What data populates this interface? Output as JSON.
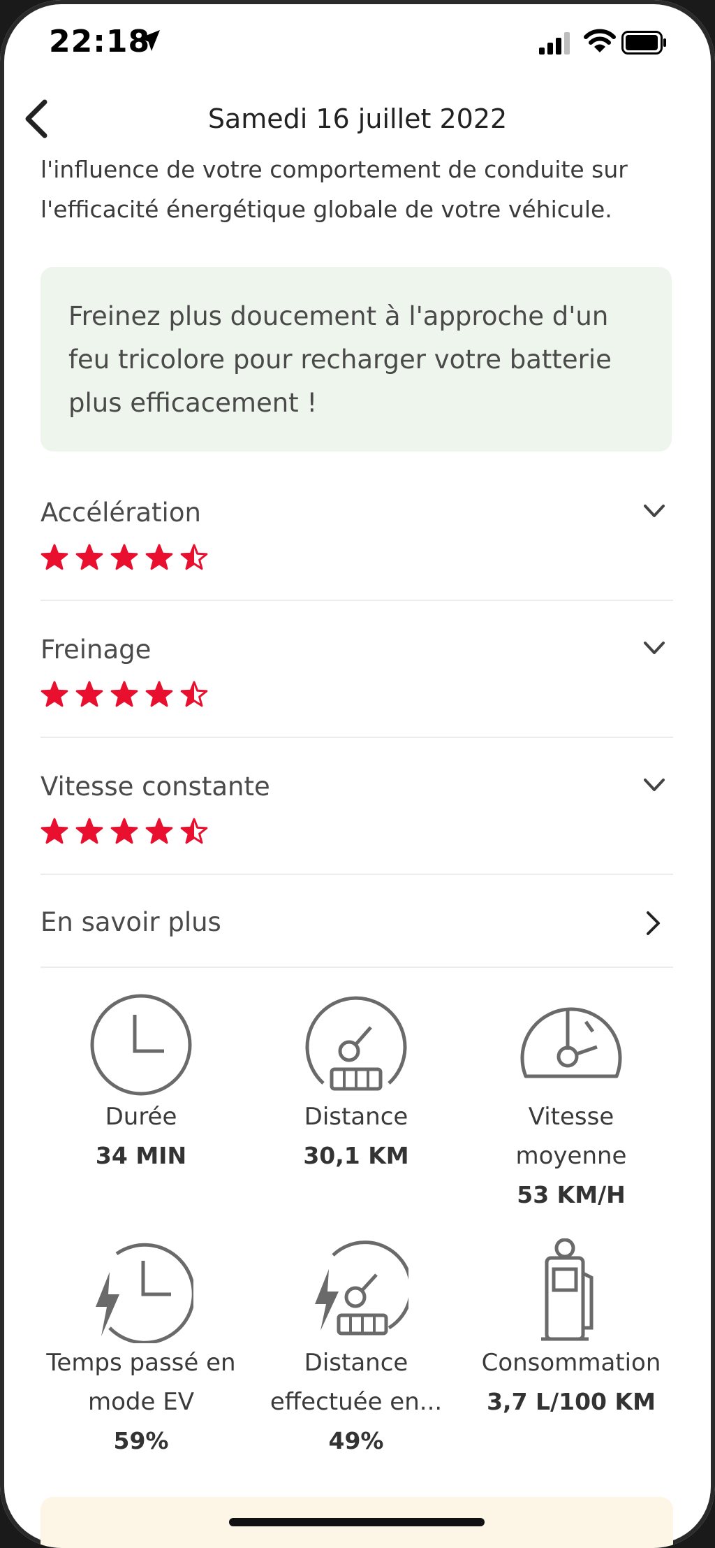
{
  "status": {
    "time": "22:18"
  },
  "header": {
    "title": "Samedi 16 juillet 2022"
  },
  "intro_text": "l'influence de votre comportement de conduite sur l'efficacité énergétique globale de votre véhicule.",
  "tip_text": "Freinez plus doucement à l'approche d'un feu tricolore pour recharger votre batterie plus efficacement !",
  "ratings": [
    {
      "label": "Accélération",
      "stars": 4.5
    },
    {
      "label": "Freinage",
      "stars": 4.5
    },
    {
      "label": "Vitesse constante",
      "stars": 4.5
    }
  ],
  "learn_more": "En savoir plus",
  "stats": [
    {
      "icon": "clock-icon",
      "caption": "Durée",
      "value": "34 MIN"
    },
    {
      "icon": "odometer-icon",
      "caption": "Distance",
      "value": "30,1 KM"
    },
    {
      "icon": "speedometer-icon",
      "caption": "Vitesse moyenne",
      "value": "53 KM/H"
    },
    {
      "icon": "ev-clock-icon",
      "caption": "Temps passé en mode EV",
      "value": "59%"
    },
    {
      "icon": "ev-odometer-icon",
      "caption": "Distance effectuée en...",
      "value": "49%"
    },
    {
      "icon": "fuel-pump-icon",
      "caption": "Consommation",
      "value": "3,7 L/100 KM"
    }
  ],
  "colors": {
    "star": "#e8102e",
    "tip_bg": "#eef5ec",
    "icon": "#6a6a6a"
  }
}
